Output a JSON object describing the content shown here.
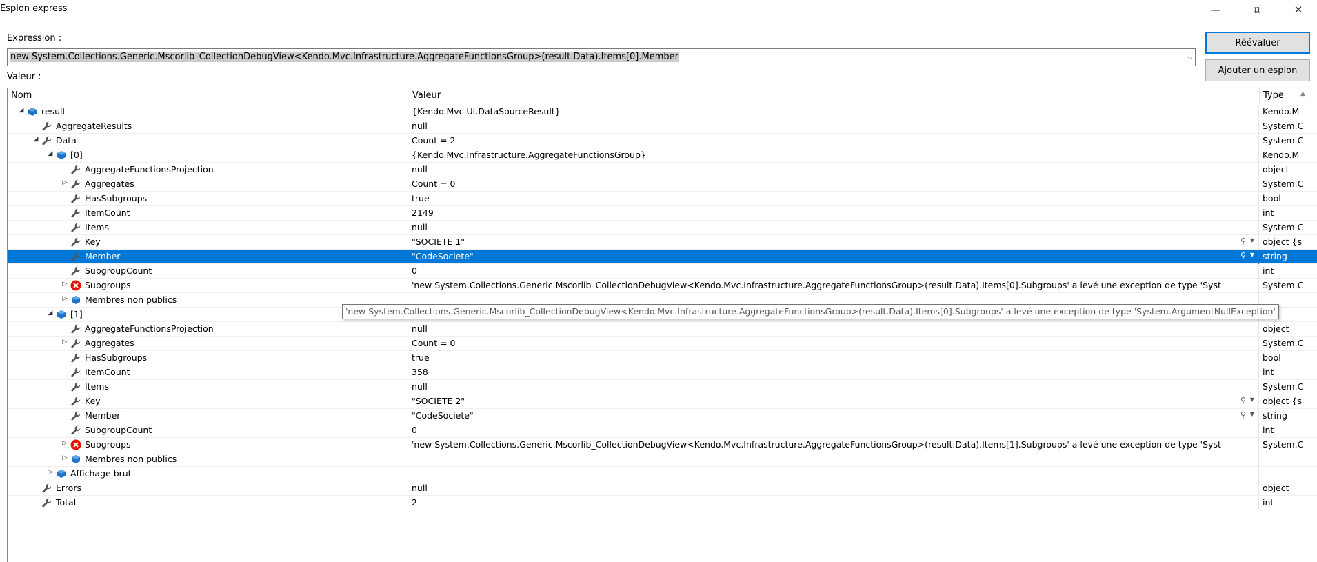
{
  "window": {
    "title": "Espion express",
    "min_icon": "minimize-icon",
    "max_icon": "restore-icon",
    "close_icon": "close-icon"
  },
  "expression": {
    "label": "Expression :",
    "value": "new System.Collections.Generic.Mscorlib_CollectionDebugView<Kendo.Mvc.Infrastructure.AggregateFunctionsGroup>(result.Data).Items[0].Member"
  },
  "buttons": {
    "reevaluate": "Réévaluer",
    "add_watch": "Ajouter un espion"
  },
  "valeur_label": "Valeur :",
  "columns": {
    "name": "Nom",
    "value": "Valeur",
    "type": "Type"
  },
  "rows": [
    {
      "name": "result",
      "value": "{Kendo.Mvc.UI.DataSourceResult}",
      "type": "Kendo.M",
      "level": 0,
      "expander": "open",
      "icon": "object"
    },
    {
      "name": "AggregateResults",
      "value": "null",
      "type": "System.C",
      "level": 1,
      "expander": "",
      "icon": "property"
    },
    {
      "name": "Data",
      "value": "Count = 2",
      "type": "System.C",
      "level": 1,
      "expander": "open",
      "icon": "property"
    },
    {
      "name": "[0]",
      "value": "{Kendo.Mvc.Infrastructure.AggregateFunctionsGroup}",
      "type": "Kendo.M",
      "level": 2,
      "expander": "open",
      "icon": "object"
    },
    {
      "name": "AggregateFunctionsProjection",
      "value": "null",
      "type": "object",
      "level": 3,
      "expander": "",
      "icon": "property"
    },
    {
      "name": "Aggregates",
      "value": "Count = 0",
      "type": "System.C",
      "level": 3,
      "expander": "closed",
      "icon": "property"
    },
    {
      "name": "HasSubgroups",
      "value": "true",
      "type": "bool",
      "level": 3,
      "expander": "",
      "icon": "property"
    },
    {
      "name": "ItemCount",
      "value": "2149",
      "type": "int",
      "level": 3,
      "expander": "",
      "icon": "property"
    },
    {
      "name": "Items",
      "value": "null",
      "type": "System.C",
      "level": 3,
      "expander": "",
      "icon": "property"
    },
    {
      "name": "Key",
      "value": "\"SOCIETE 1\"",
      "type": "object {s",
      "level": 3,
      "expander": "",
      "icon": "property",
      "viz": true
    },
    {
      "name": "Member",
      "value": "\"CodeSociete\"",
      "type": "string",
      "level": 3,
      "expander": "",
      "icon": "property",
      "viz": true,
      "selected": true
    },
    {
      "name": "SubgroupCount",
      "value": "0",
      "type": "int",
      "level": 3,
      "expander": "",
      "icon": "property"
    },
    {
      "name": "Subgroups",
      "value": "'new System.Collections.Generic.Mscorlib_CollectionDebugView<Kendo.Mvc.Infrastructure.AggregateFunctionsGroup>(result.Data).Items[0].Subgroups' a levé une exception de type 'Syst",
      "type": "System.C",
      "level": 3,
      "expander": "closed",
      "icon": "error"
    },
    {
      "name": "Membres non publics",
      "value": "",
      "type": "",
      "level": 3,
      "expander": "closed",
      "icon": "object"
    },
    {
      "name": "[1]",
      "value": "",
      "type": "",
      "level": 2,
      "expander": "open",
      "icon": "object"
    },
    {
      "name": "AggregateFunctionsProjection",
      "value": "null",
      "type": "object",
      "level": 3,
      "expander": "",
      "icon": "property"
    },
    {
      "name": "Aggregates",
      "value": "Count = 0",
      "type": "System.C",
      "level": 3,
      "expander": "closed",
      "icon": "property"
    },
    {
      "name": "HasSubgroups",
      "value": "true",
      "type": "bool",
      "level": 3,
      "expander": "",
      "icon": "property"
    },
    {
      "name": "ItemCount",
      "value": "358",
      "type": "int",
      "level": 3,
      "expander": "",
      "icon": "property"
    },
    {
      "name": "Items",
      "value": "null",
      "type": "System.C",
      "level": 3,
      "expander": "",
      "icon": "property"
    },
    {
      "name": "Key",
      "value": "\"SOCIETE 2\"",
      "type": "object {s",
      "level": 3,
      "expander": "",
      "icon": "property",
      "viz": true
    },
    {
      "name": "Member",
      "value": "\"CodeSociete\"",
      "type": "string",
      "level": 3,
      "expander": "",
      "icon": "property",
      "viz": true
    },
    {
      "name": "SubgroupCount",
      "value": "0",
      "type": "int",
      "level": 3,
      "expander": "",
      "icon": "property"
    },
    {
      "name": "Subgroups",
      "value": "'new System.Collections.Generic.Mscorlib_CollectionDebugView<Kendo.Mvc.Infrastructure.AggregateFunctionsGroup>(result.Data).Items[1].Subgroups' a levé une exception de type 'Syst",
      "type": "System.C",
      "level": 3,
      "expander": "closed",
      "icon": "error"
    },
    {
      "name": "Membres non publics",
      "value": "",
      "type": "",
      "level": 3,
      "expander": "closed",
      "icon": "object"
    },
    {
      "name": "Affichage brut",
      "value": "",
      "type": "",
      "level": 2,
      "expander": "closed",
      "icon": "object"
    },
    {
      "name": "Errors",
      "value": "null",
      "type": "object",
      "level": 1,
      "expander": "",
      "icon": "property"
    },
    {
      "name": "Total",
      "value": "2",
      "type": "int",
      "level": 1,
      "expander": "",
      "icon": "property"
    }
  ],
  "tooltip": "'new System.Collections.Generic.Mscorlib_CollectionDebugView<Kendo.Mvc.Infrastructure.AggregateFunctionsGroup>(result.Data).Items[0].Subgroups' a levé une exception de type 'System.ArgumentNullException'",
  "colors": {
    "selection": "#0078d7",
    "object_icon": "#1e74c6",
    "property_icon": "#555555",
    "error_icon": "#e51400"
  }
}
